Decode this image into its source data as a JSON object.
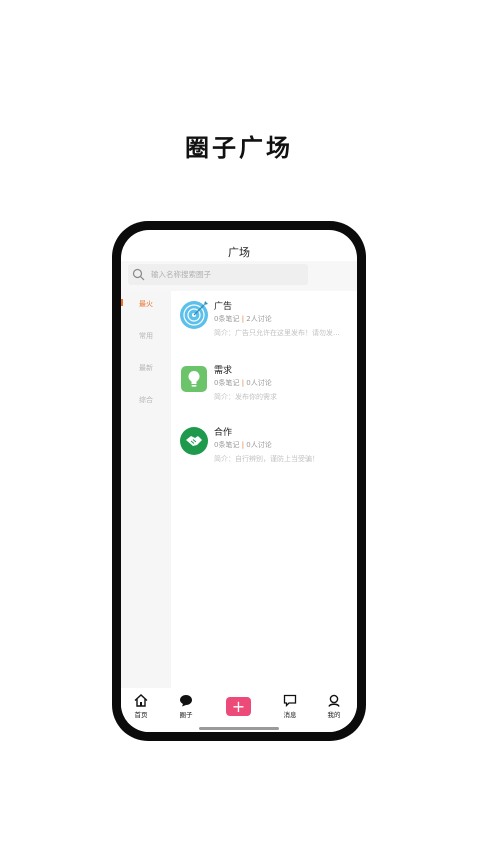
{
  "hero_title": "圈子广场",
  "nav": {
    "title": "广场"
  },
  "search": {
    "placeholder": "输入名称搜索圈子"
  },
  "sidebar": {
    "items": [
      {
        "label": "最火",
        "active": true
      },
      {
        "label": "常用",
        "active": false
      },
      {
        "label": "最新",
        "active": false
      },
      {
        "label": "综合",
        "active": false
      }
    ]
  },
  "circles": [
    {
      "name": "广告",
      "notes": "0条笔记",
      "separator": "|",
      "discussions": "2人讨论",
      "desc": "简介：广告只允许在这里发布！请勿发...",
      "icon": "target-icon",
      "color": "#5bc0eb"
    },
    {
      "name": "需求",
      "notes": "0条笔记",
      "separator": "|",
      "discussions": "0人讨论",
      "desc": "简介：发布你的需求",
      "icon": "lightbulb-icon",
      "color": "#6cc46a"
    },
    {
      "name": "合作",
      "notes": "0条笔记",
      "separator": "|",
      "discussions": "0人讨论",
      "desc": "简介：自行辨别，谨防上当受骗！",
      "icon": "handshake-icon",
      "color": "#1f9a4c"
    }
  ],
  "tabbar": {
    "home": "首页",
    "circle": "圈子",
    "add": "+",
    "messages": "消息",
    "mine": "我的"
  },
  "colors": {
    "accent": "#e8742c",
    "add_button": "#ec4a78"
  }
}
